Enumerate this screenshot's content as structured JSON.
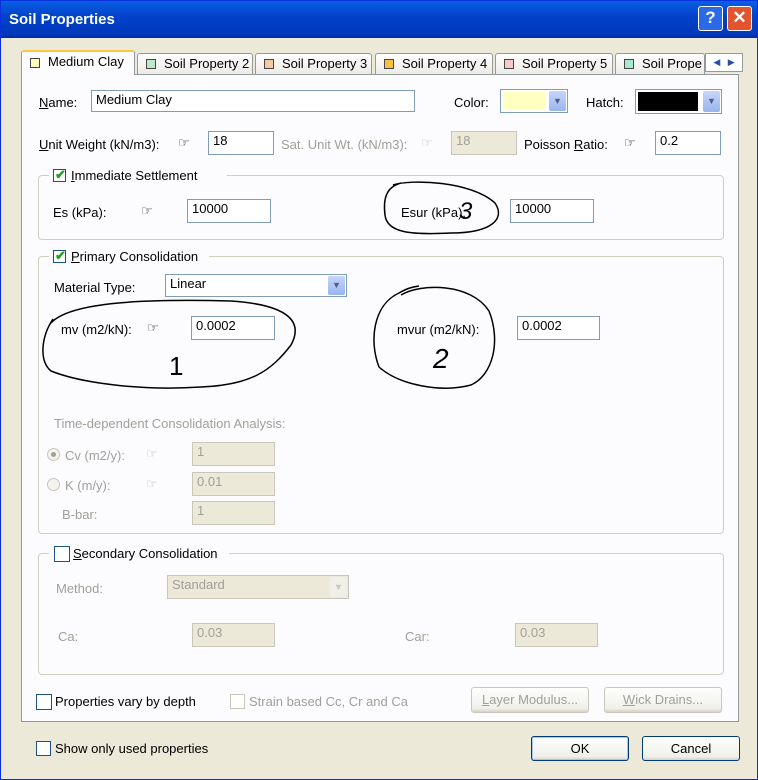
{
  "window": {
    "title": "Soil Properties",
    "help": "?",
    "close": "✕"
  },
  "tabs": [
    {
      "label": "Medium Clay",
      "color": "#ffffc0"
    },
    {
      "label": "Soil Property 2",
      "color": "#c0e8c8"
    },
    {
      "label": "Soil Property 3",
      "color": "#f8c8a0"
    },
    {
      "label": "Soil Property 4",
      "color": "#f8c040"
    },
    {
      "label": "Soil Property 5",
      "color": "#f8c8c8"
    },
    {
      "label": "Soil Prope",
      "color": "#a8e8d0"
    }
  ],
  "tab_scroll": {
    "left": "◀",
    "right": "▶"
  },
  "props": {
    "name_label": "Name:",
    "name_value": "Medium Clay",
    "color_label": "Color:",
    "color_value": "#ffffc0",
    "hatch_label": "Hatch:",
    "hatch_value": "#000000",
    "unit_weight_label": "Unit Weight (kN/m3):",
    "unit_weight_value": "18",
    "sat_unit_weight_label": "Sat. Unit Wt. (kN/m3):",
    "sat_unit_weight_value": "18",
    "poisson_label": "Poisson Ratio:",
    "poisson_value": "0.2"
  },
  "immediate": {
    "label": "Immediate Settlement",
    "checked": "✔",
    "es_label": "Es (kPa):",
    "es_value": "10000",
    "esur_label": "Esur (kPa):",
    "esur_value": "10000",
    "annotation": "3"
  },
  "primary": {
    "label": "Primary Consolidation",
    "checked": "✔",
    "material_type_label": "Material Type:",
    "material_type_value": "Linear",
    "mv_label": "mv (m2/kN):",
    "mv_value": "0.0002",
    "mv_annotation": "1",
    "mvur_label": "mvur (m2/kN):",
    "mvur_value": "0.0002",
    "mvur_annotation": "2",
    "time_dep_label": "Time-dependent Consolidation Analysis:",
    "cv_label": "Cv (m2/y):",
    "cv_value": "1",
    "k_label": "K (m/y):",
    "k_value": "0.01",
    "bbar_label": "B-bar:",
    "bbar_value": "1"
  },
  "secondary": {
    "label": "Secondary Consolidation",
    "method_label": "Method:",
    "method_value": "Standard",
    "ca_label": "Ca:",
    "ca_value": "0.03",
    "car_label": "Car:",
    "car_value": "0.03"
  },
  "bottom": {
    "vary_depth_label": "Properties vary by depth",
    "strain_label": "Strain based Cc, Cr and Ca",
    "layer_modulus": "Layer Modulus...",
    "wick_drains": "Wick Drains...",
    "show_used_label": "Show only used properties",
    "ok": "OK",
    "cancel": "Cancel"
  },
  "icons": {
    "link": "hand-pointer-icon",
    "dropdown": "chevron-down-icon"
  }
}
